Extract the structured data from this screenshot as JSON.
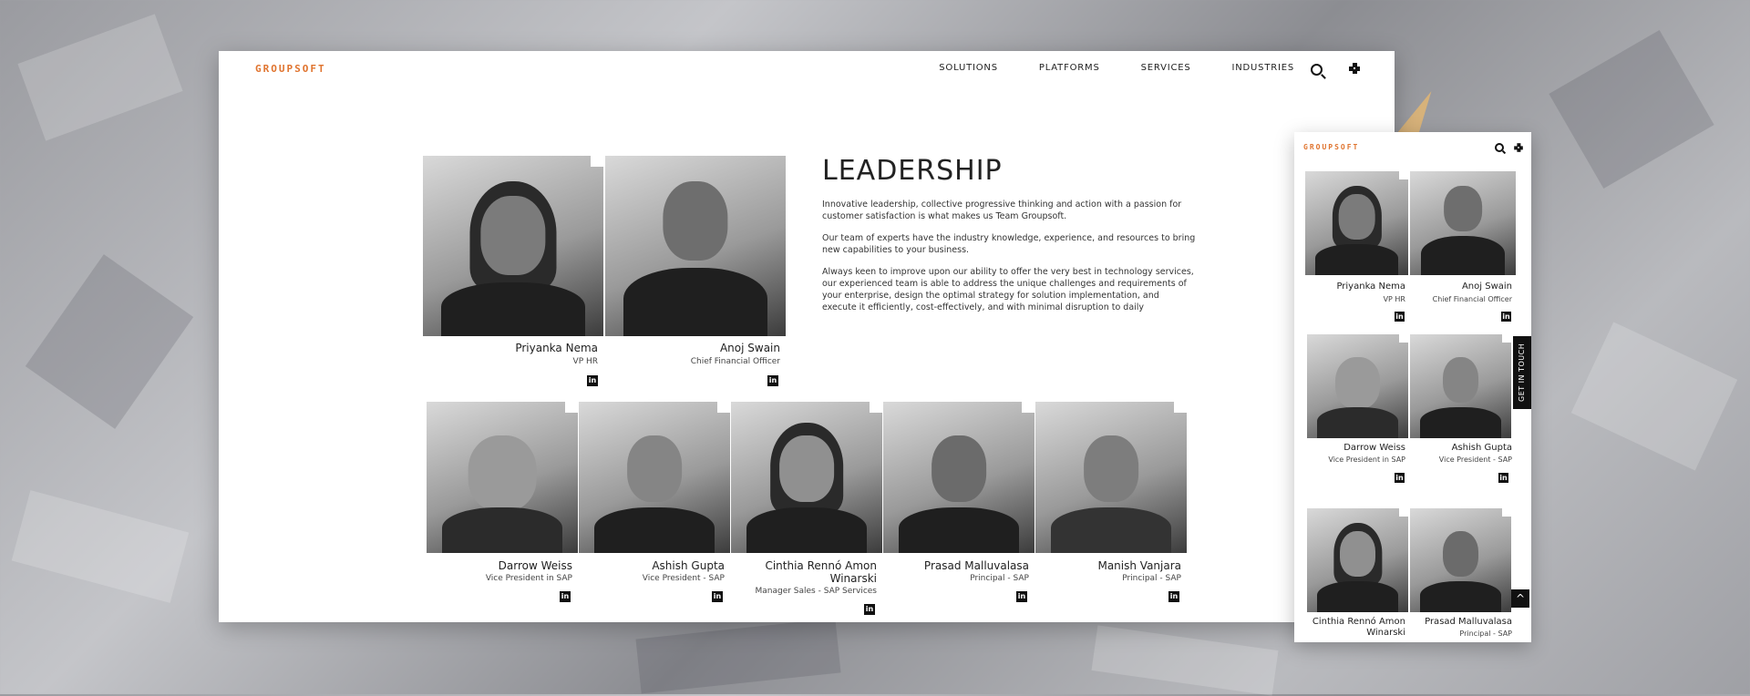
{
  "brand": {
    "logo": "GROUPSOFT",
    "accent": "#e0742f"
  },
  "nav": {
    "items": [
      "SOLUTIONS",
      "PLATFORMS",
      "SERVICES",
      "INDUSTRIES"
    ]
  },
  "leadership": {
    "title": "LEADERSHIP",
    "paragraphs": [
      "Innovative leadership, collective progressive thinking and action with a passion for customer satisfaction is what makes us Team Groupsoft.",
      "Our team of experts have the industry knowledge, experience, and resources to bring new capabilities to your business.",
      "Always keen to improve upon our ability to offer the very best in technology services, our experienced team is able to address the unique challenges and requirements of your enterprise, design the optimal strategy for solution implementation, and execute it efficiently, cost-effectively, and with minimal disruption to daily"
    ]
  },
  "people": [
    {
      "name": "Priyanka Nema",
      "role": "VP HR"
    },
    {
      "name": "Anoj Swain",
      "role": "Chief Financial Officer"
    },
    {
      "name": "Darrow Weiss",
      "role": "Vice President in SAP"
    },
    {
      "name": "Ashish Gupta",
      "role": "Vice President - SAP"
    },
    {
      "name": "Cinthia Rennó Amon Winarski",
      "role": "Manager Sales - SAP Services"
    },
    {
      "name": "Prasad Malluvalasa",
      "role": "Principal - SAP"
    },
    {
      "name": "Manish Vanjara",
      "role": "Principal - SAP"
    }
  ],
  "mobile": {
    "get_in_touch": "GET IN TOUCH",
    "linkedin_glyph": "in",
    "scroll_top_glyph": "^"
  },
  "icons": {
    "search": "search-icon",
    "menu": "grid-menu-icon",
    "linkedin": "linkedin-icon"
  }
}
